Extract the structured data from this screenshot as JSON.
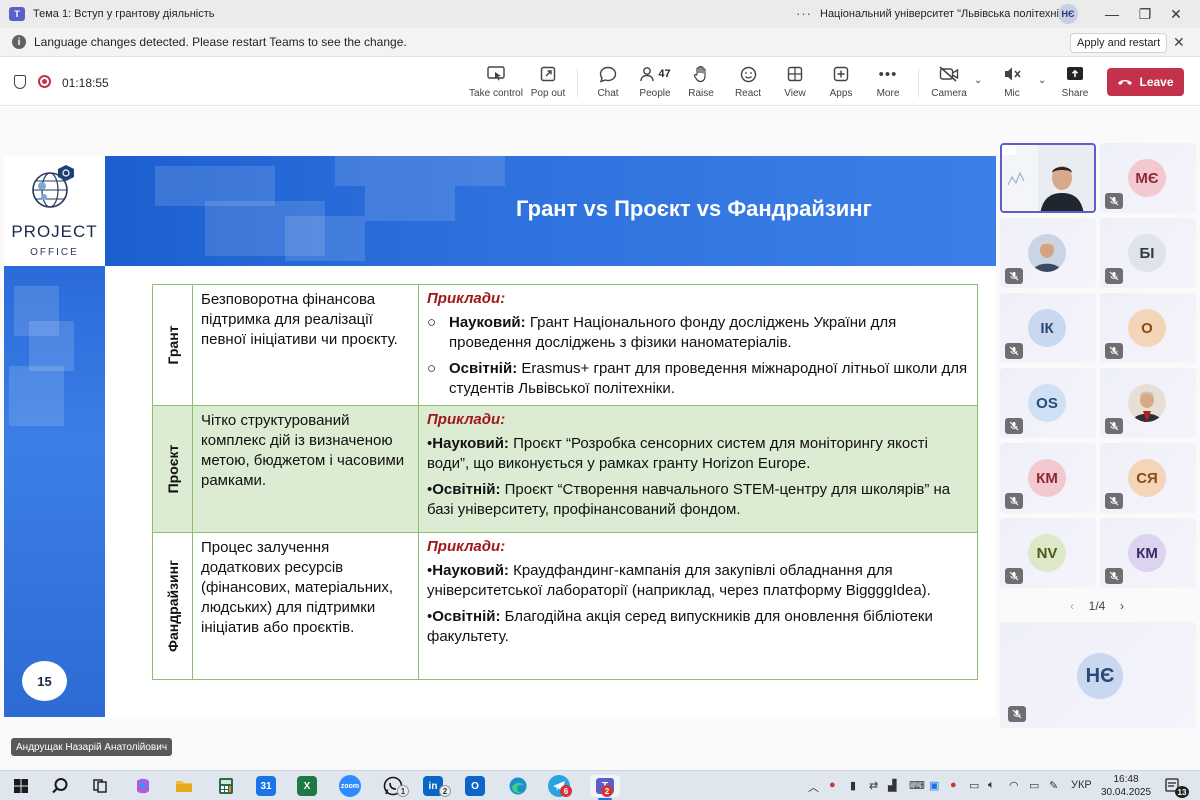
{
  "window": {
    "title": "Тема 1: Вступ у грантову діяльність",
    "more": "···",
    "organization": "Національний університет \"Львівська політехніка\"",
    "user_initials": "НЄ",
    "minimize": "—",
    "maximize": "❐",
    "close": "✕"
  },
  "notification": {
    "icon": "i",
    "message": "Language changes detected. Please restart Teams to see the change.",
    "button": "Apply and restart",
    "close": "✕"
  },
  "meeting": {
    "timer": "01:18:55",
    "toolbar": [
      {
        "key": "take_control",
        "label": "Take control",
        "icon": "take-control-icon"
      },
      {
        "key": "pop_out",
        "label": "Pop out",
        "icon": "pop-out-icon"
      },
      {
        "key": "chat",
        "label": "Chat",
        "icon": "chat-icon"
      },
      {
        "key": "people",
        "label": "People",
        "icon": "people-icon",
        "count": "47"
      },
      {
        "key": "raise",
        "label": "Raise",
        "icon": "hand-icon"
      },
      {
        "key": "react",
        "label": "React",
        "icon": "smile-icon"
      },
      {
        "key": "view",
        "label": "View",
        "icon": "view-grid-icon"
      },
      {
        "key": "apps",
        "label": "Apps",
        "icon": "apps-plus-icon"
      },
      {
        "key": "more",
        "label": "More",
        "icon": "more-icon"
      },
      {
        "key": "camera",
        "label": "Camera",
        "icon": "camera-off-icon"
      },
      {
        "key": "mic",
        "label": "Mic",
        "icon": "mic-off-icon"
      },
      {
        "key": "share",
        "label": "Share",
        "icon": "share-icon"
      }
    ],
    "leave_label": "Leave",
    "leave_color": "#c4314b"
  },
  "slide": {
    "title": "Грант vs Проєкт vs Фандрайзинг",
    "logo_word": "PROJECT",
    "logo_sub": "OFFICE",
    "page_number": "15",
    "accent_color": "#2f72de",
    "examples_color": "#a01818",
    "rows": [
      {
        "label": "Грант",
        "definition": "Безповоротна фінансова підтримка для реалізації певної ініціативи чи проєкту.",
        "examples_heading": "Приклади:",
        "bullet": "○",
        "items": [
          {
            "kind": "Науковий:",
            "text": " Грант Національного фонду досліджень України для проведення досліджень з фізики наноматеріалів."
          },
          {
            "kind": "Освітній:",
            "text": " Erasmus+ грант для проведення міжнародної літньої школи для студентів Львівської політехніки."
          }
        ]
      },
      {
        "label": "Проєкт",
        "definition": "Чітко структурований комплекс дій із визначеною метою, бюджетом і часовими рамками.",
        "examples_heading": "Приклади:",
        "bullet": "•",
        "items": [
          {
            "kind": "Науковий:",
            "text": " Проєкт “Розробка сенсорних систем для моніторингу якості води”, що виконується у рамках гранту Horizon Europe."
          },
          {
            "kind": "Освітній:",
            "text": " Проєкт “Створення навчального STEM-центру для школярів” на базі університету, профінансований фондом."
          }
        ]
      },
      {
        "label": "Фандрайзинг",
        "definition": "Процес залучення додаткових ресурсів (фінансових, матеріальних, людських) для підтримки ініціатив або проєктів.",
        "examples_heading": "Приклади:",
        "bullet": "•",
        "items": [
          {
            "kind": "Науковий:",
            "text": " Краудфандинг-кампанія для закупівлі обладнання для університетської лабораторії (наприклад, через платформу BiggggIdea)."
          },
          {
            "kind": "Освітній:",
            "text": " Благодійна акція серед випускників для оновлення бібліотеки факультету."
          }
        ]
      }
    ]
  },
  "participants": {
    "tiles": [
      {
        "initials": "",
        "video": true,
        "photo": "presenter-video",
        "muted": false,
        "active": true
      },
      {
        "initials": "МЄ",
        "bg": "#f3c9cf",
        "fg": "#8a2a38",
        "muted": true
      },
      {
        "initials": "",
        "photo": "person-photo",
        "bg": "#cfd8e8",
        "muted": true
      },
      {
        "initials": "БІ",
        "bg": "#dfe3ea",
        "fg": "#2e3a4a",
        "muted": true
      },
      {
        "initials": "ІК",
        "bg": "#c9d7ef",
        "fg": "#2b4a7a",
        "muted": true
      },
      {
        "initials": "О",
        "bg": "#f5d5b8",
        "fg": "#8a4a1a",
        "muted": true
      },
      {
        "initials": "OS",
        "bg": "#cfe0f5",
        "fg": "#2b4a7a",
        "muted": true
      },
      {
        "initials": "",
        "photo": "person-photo",
        "bg": "#e7dfd3",
        "muted": true
      },
      {
        "initials": "КМ",
        "bg": "#f3c9cf",
        "fg": "#8a2a38",
        "muted": true
      },
      {
        "initials": "СЯ",
        "bg": "#f5d5b8",
        "fg": "#8a4a1a",
        "muted": true
      },
      {
        "initials": "NV",
        "bg": "#dde8c8",
        "fg": "#4a5a1a",
        "muted": true
      },
      {
        "initials": "КМ",
        "bg": "#dcd3f0",
        "fg": "#3d2a6b",
        "muted": true
      }
    ],
    "pager": {
      "prev": "‹",
      "label": "1/4",
      "next": "›"
    },
    "self_initials": "НЄ"
  },
  "presenter_name": "Андрущак Назарій Анатолійович",
  "taskbar": {
    "apps": [
      {
        "name": "start-icon",
        "glyph": "",
        "bg": "#0a6cd6"
      },
      {
        "name": "search-icon",
        "glyph": "",
        "bg": "transparent"
      },
      {
        "name": "task-view-icon",
        "glyph": "",
        "bg": "transparent"
      },
      {
        "name": "copilot-icon",
        "glyph": "",
        "bg": "#b259e0"
      },
      {
        "name": "file-explorer-icon",
        "glyph": "",
        "bg": "#e8b02a"
      },
      {
        "name": "calculator-icon",
        "glyph": "",
        "bg": "#2a6a4a"
      },
      {
        "name": "calendar-icon",
        "glyph": "31",
        "bg": "#1a73e8"
      },
      {
        "name": "excel-icon",
        "glyph": "X",
        "bg": "#1d7a45"
      },
      {
        "name": "zoom-icon",
        "glyph": "zoom",
        "bg": "#2d8cff"
      },
      {
        "name": "whatsapp-icon",
        "glyph": "",
        "bg": "#25a244",
        "badge": "1"
      },
      {
        "name": "linkedin-icon",
        "glyph": "in",
        "bg": "#0a66c2",
        "badge": "2"
      },
      {
        "name": "outlook-icon",
        "glyph": "O",
        "bg": "#0f64c8"
      },
      {
        "name": "edge-icon",
        "glyph": "",
        "bg": "#1c8fd0"
      },
      {
        "name": "telegram-icon",
        "glyph": "",
        "bg": "#2aa3df",
        "badge": "6"
      },
      {
        "name": "teams-icon",
        "glyph": "T",
        "bg": "#5b5fc7",
        "badge": "2",
        "active": true
      }
    ],
    "tray_language": "УКР",
    "time": "16:48",
    "date": "30.04.2025",
    "notification_count": "13"
  }
}
